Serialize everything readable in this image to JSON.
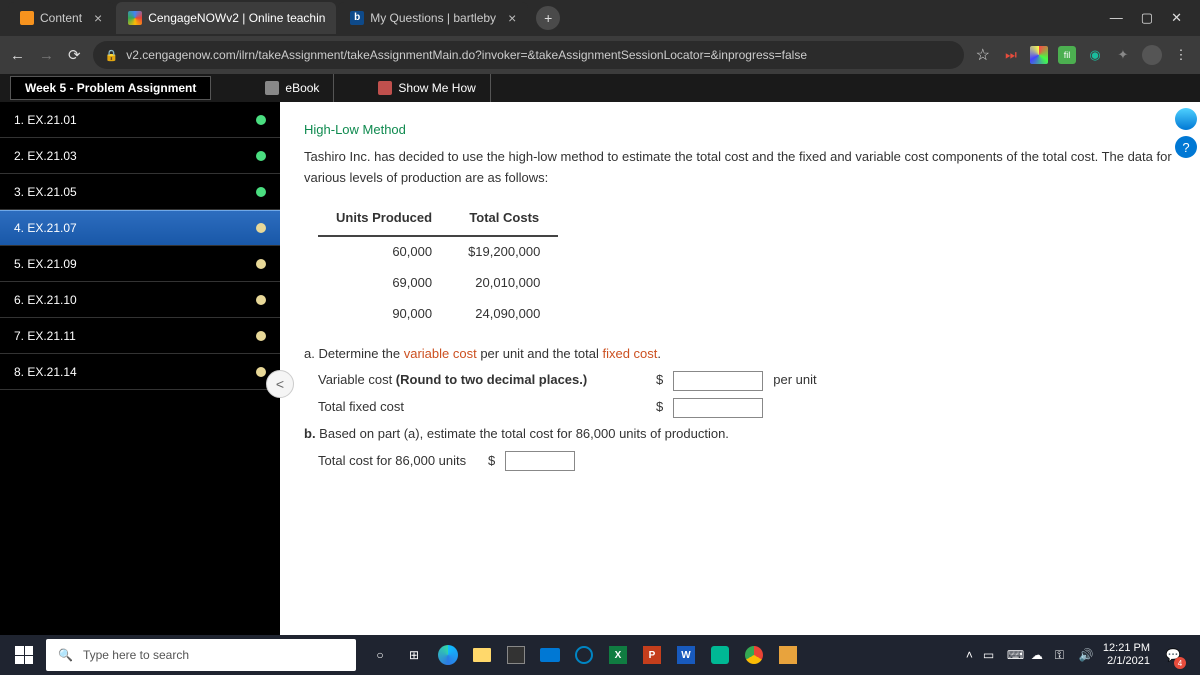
{
  "browser": {
    "tabs": [
      {
        "title": "Content"
      },
      {
        "title": "CengageNOWv2 | Online teachin"
      },
      {
        "title": "My Questions | bartleby"
      }
    ],
    "url": "v2.cengagenow.com/ilrn/takeAssignment/takeAssignmentMain.do?invoker=&takeAssignmentSessionLocator=&inprogress=false"
  },
  "assignment": {
    "title": "Week 5 - Problem Assignment",
    "tools": {
      "ebook": "eBook",
      "show_me": "Show Me How"
    },
    "questions": [
      "1. EX.21.01",
      "2. EX.21.03",
      "3. EX.21.05",
      "4. EX.21.07",
      "5. EX.21.09",
      "6. EX.21.10",
      "7. EX.21.11",
      "8. EX.21.14"
    ],
    "content": {
      "section_title": "High-Low Method",
      "intro": "Tashiro Inc. has decided to use the high-low method to estimate the total cost and the fixed and variable cost components of the total cost. The data for various levels of production are as follows:",
      "table": {
        "h1": "Units Produced",
        "h2": "Total Costs",
        "rows": [
          {
            "u": "60,000",
            "c": "$19,200,000"
          },
          {
            "u": "69,000",
            "c": "20,010,000"
          },
          {
            "u": "90,000",
            "c": "24,090,000"
          }
        ]
      },
      "part_a_prefix": "a.  Determine the ",
      "part_a_term1": "variable cost",
      "part_a_mid": " per unit and the total ",
      "part_a_term2": "fixed cost",
      "part_a_suffix": ".",
      "vc_label": "Variable cost ",
      "vc_bold": "(Round to two decimal places.)",
      "per_unit": "per unit",
      "fc_label": "Total fixed cost",
      "part_b_prefix": "b.",
      "part_b_text": "  Based on part (a), estimate the total cost for 86,000 units of production.",
      "tc_label": "Total cost for 86,000 units",
      "dollar": "$"
    }
  },
  "taskbar": {
    "search_placeholder": "Type here to search",
    "time": "12:21 PM",
    "date": "2/1/2021",
    "notif_count": "4"
  }
}
